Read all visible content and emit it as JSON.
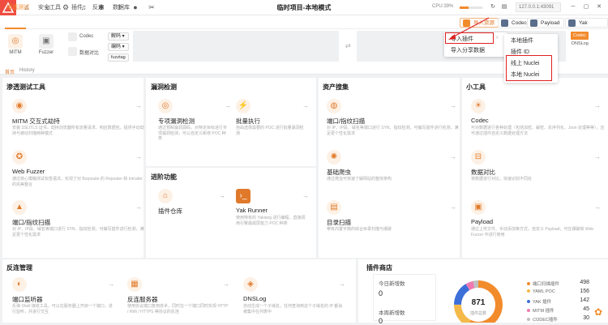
{
  "window": {
    "title": "临时项目-本地模式",
    "cpu_label": "CPU:39%",
    "cpu_percent": 39,
    "engine_addr": "127.0.0.1:43091"
  },
  "nav": {
    "items": [
      "渗透测试",
      "安全工具",
      "插件",
      "反连",
      "数据库"
    ],
    "active": "渗透测试"
  },
  "nav_buttons": {
    "import": "导入资源",
    "codec": "Codec",
    "payload": "Payload",
    "yakrunner": "Yak Runner"
  },
  "toolbar": {
    "mitm": "MITM",
    "fuzzer": "Fuzzer",
    "codec": "Codec",
    "datadiff": "数据对比",
    "decode": "解码",
    "encode": "编码",
    "fuzztag": "fuzztag",
    "codec_tag": "Codec",
    "dnslog_tag": "DNSLog"
  },
  "tabs": [
    "首页",
    "History"
  ],
  "menus": {
    "import_plugin": "导入插件",
    "import_share": "导入分享数据",
    "sub": [
      "本地插件",
      "插件 ID",
      "线上 Nuclei",
      "本地 Nuclei"
    ]
  },
  "sections": {
    "pentest": {
      "title": "渗透测试工具",
      "cards": [
        {
          "name": "MITM 交互式劫持",
          "desc": "安装 SSL/TLS 证书，劫持浏览器所有流量请求、响应数据包，提供手动劫持与被动扫描两种模式"
        },
        {
          "name": "Web Fuzzer",
          "desc": "通过核心模糊测试标签语法，实现了对 Burpsuite 的 Repeater 和 Intruder 的完美整合"
        },
        {
          "name": "端口/指纹扫描",
          "desc": "对 IP、IP段、域名等端口进行 SYN、指纹检测，可编写插件进行检测，满足更个性化需求"
        }
      ]
    },
    "vuln": {
      "title": "漏洞检测",
      "cards": [
        {
          "name": "专项漏洞检测",
          "desc": "通过预制漏洞源码，对特定目标进行专项漏洞检测，可以自定义新增 POC 种类"
        },
        {
          "name": "批量执行",
          "desc": "自由选择需要的 POC 进行批量漏洞检测"
        }
      ]
    },
    "advanced": {
      "title": "进阶功能",
      "cards": [
        {
          "name": "插件仓库",
          "desc": ""
        },
        {
          "name": "Yak Runner",
          "desc": "使用特有的 Yaklang 进行编程，直接调用引擎最底层能力 POC 种类"
        }
      ]
    },
    "asset": {
      "title": "资产搜集",
      "cards": [
        {
          "name": "端口/指纹扫描",
          "desc": "对 IP、IP段、域名等端口进行 SYN、指纹检测，可编写插件进行检测，满足更个性化需求"
        },
        {
          "name": "基础爬虫",
          "desc": "通过爬虫可快速了解网站的整体架构"
        },
        {
          "name": "目录扫描",
          "desc": "带有内置字典的综合目录扫描与爆破"
        }
      ]
    },
    "tools": {
      "title": "小工具",
      "cards": [
        {
          "name": "Codec",
          "desc": "可对数据进行各种处理（包括加密、解密、反序列化、Json 处理等等），还可通过插件自定义数据处理方法"
        },
        {
          "name": "数据对比",
          "desc": "将数据进行对比，快速识别不同处"
        },
        {
          "name": "Payload",
          "desc": "通过上传文件、手动添加等方式，自定义 Payload，可在爆破和 Web Fuzzer 中进行使用"
        }
      ]
    },
    "reverse": {
      "title": "反连管理",
      "cards": [
        {
          "name": "端口监听器",
          "desc": "反弹 Shell 接收工具，可以在服务器上开启一个端口，进行监听，并进行交互"
        },
        {
          "name": "反连服务器",
          "desc": "使用协议端口复用技术，同时在一个端口同时实现 HTTP / RMI / HTTPS 等协议的反连"
        },
        {
          "name": "DNSLog",
          "desc": "自动生成一个子域名，任何查询到这个子域名的 IP 都会被集中在列表中"
        }
      ]
    },
    "store": {
      "title": "插件商店",
      "today_label": "今日新增数",
      "today_value": "0",
      "week_label": "本周新增数",
      "week_value": "0",
      "total": "871",
      "total_label": "插件总数"
    }
  },
  "chart_data": {
    "type": "pie",
    "categories": [
      "端口扫描插件",
      "YAML POC",
      "YAK 插件",
      "MITM 插件",
      "CODEC插件"
    ],
    "values": [
      498,
      156,
      142,
      45,
      30
    ],
    "colors": [
      "#f28b2c",
      "#f5b94a",
      "#3d6fd9",
      "#f07ab0",
      "#c0c0c0"
    ]
  }
}
